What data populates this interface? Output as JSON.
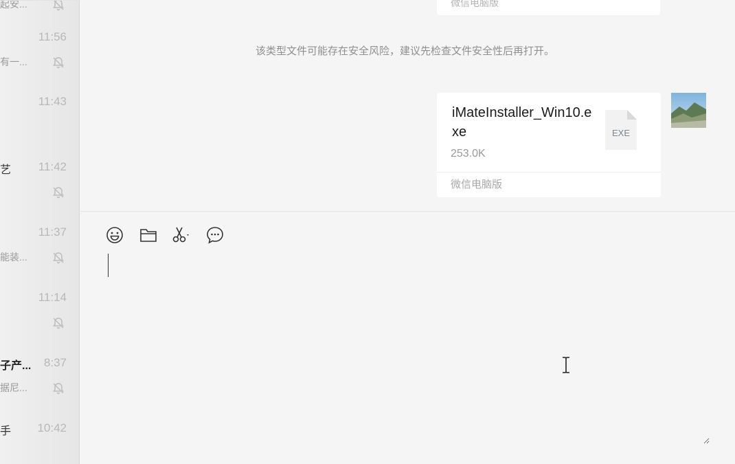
{
  "sidebar": {
    "items": [
      {
        "time": "",
        "title": "",
        "preview": "起安...",
        "muted": true
      },
      {
        "time": "11:56",
        "title": "",
        "preview": "有一...",
        "muted": true
      },
      {
        "time": "11:43",
        "title": "",
        "preview": "",
        "muted": false
      },
      {
        "time": "11:42",
        "title": "艺",
        "preview": "",
        "muted": true
      },
      {
        "time": "11:37",
        "title": "",
        "preview": "能装...",
        "muted": true
      },
      {
        "time": "11:14",
        "title": "",
        "preview": "",
        "muted": true
      },
      {
        "time": "8:37",
        "title": "子产...",
        "preview": "据尼...",
        "muted": true
      },
      {
        "time": "10:42",
        "title": "手",
        "preview": "",
        "muted": false
      }
    ]
  },
  "chat": {
    "previous_source": "微信电脑版",
    "security_notice": "该类型文件可能存在安全风险，建议先检查文件安全性后再打开。",
    "file_message": {
      "file_name": "iMateInstaller_Win10.exe",
      "file_size": "253.0K",
      "file_ext": "EXE",
      "source": "微信电脑版"
    }
  },
  "input": {
    "toolbar": [
      "emoji-icon",
      "folder-icon",
      "scissors-icon",
      "chat-history-icon"
    ],
    "value": ""
  },
  "colors": {
    "background": "#f5f5f5",
    "sidebar": "#ececec",
    "bubble": "#ffffff",
    "muted_text": "#999999"
  }
}
